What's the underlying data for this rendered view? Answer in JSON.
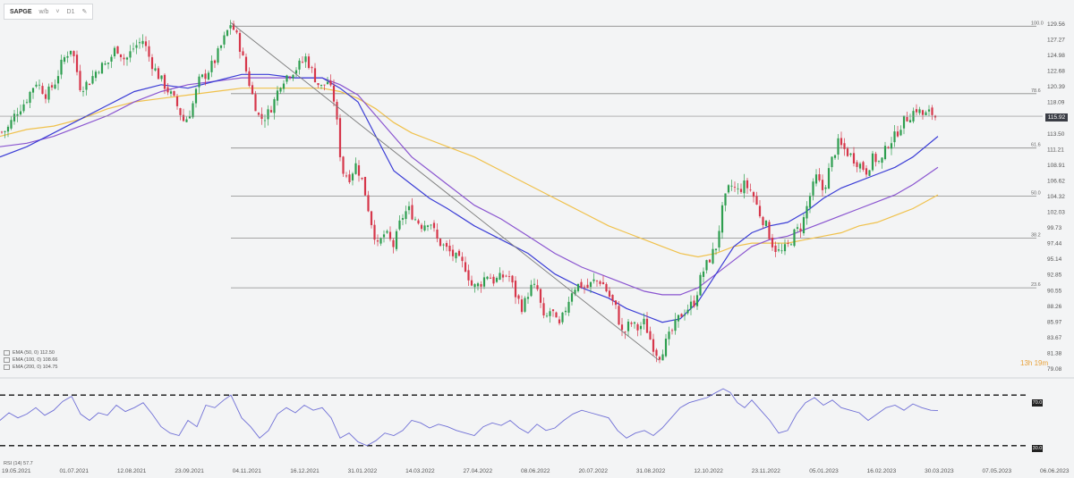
{
  "toolbar": {
    "symbol": "SAPGE",
    "interval_label": "w/b",
    "period_label": "D1"
  },
  "price_axis_labels": [
    "129.56",
    "127.27",
    "124.98",
    "122.68",
    "120.39",
    "118.09",
    "115.92",
    "113.50",
    "111.21",
    "108.91",
    "106.62",
    "104.32",
    "102.03",
    "99.73",
    "97.44",
    "95.14",
    "92.85",
    "90.55",
    "88.26",
    "85.97",
    "83.67",
    "81.38",
    "79.08"
  ],
  "current_price": "115.92",
  "countdown": "13h 19m",
  "legend": [
    {
      "label": "EMA (50, 0) 112.50",
      "color": "#3b3dd6"
    },
    {
      "label": "EMA (100, 0) 108.66",
      "color": "#8a55d0"
    },
    {
      "label": "EMA (200, 0) 104.75",
      "color": "#f0c14b"
    }
  ],
  "rsi": {
    "label": "RSI (14) 57.7",
    "upper": "70.0",
    "lower": "30.0"
  },
  "colors": {
    "up": "#2e9e4f",
    "down": "#d6364a",
    "ema50": "#3b3dd6",
    "ema100": "#8a55d0",
    "ema200": "#f0c14b",
    "rsi": "#6f6fd6",
    "fib": "#8a8a8a"
  },
  "chart_data": {
    "type": "candlestick",
    "x_tick_labels": [
      "19.05.2021",
      "01.07.2021",
      "12.08.2021",
      "23.09.2021",
      "04.11.2021",
      "16.12.2021",
      "31.01.2022",
      "14.03.2022",
      "27.04.2022",
      "08.06.2022",
      "20.07.2022",
      "31.08.2022",
      "12.10.2022",
      "23.11.2022",
      "05.01.2023",
      "16.02.2023",
      "30.03.2023",
      "07.05.2023",
      "06.06.2023"
    ],
    "ylim": [
      79.08,
      129.56
    ],
    "fibonacci_levels": [
      {
        "label": "100.0",
        "value": 129.0
      },
      {
        "label": "78.6",
        "value": 119.2
      },
      {
        "label": "61.6",
        "value": 111.3
      },
      {
        "label": "50.0",
        "value": 104.3
      },
      {
        "label": "38.2",
        "value": 98.2
      },
      {
        "label": "23.6",
        "value": 91.0
      }
    ],
    "price_path": [
      [
        0,
        113.5
      ],
      [
        8,
        114
      ],
      [
        18,
        116.5
      ],
      [
        28,
        118
      ],
      [
        40,
        121
      ],
      [
        52,
        119
      ],
      [
        62,
        121
      ],
      [
        70,
        124
      ],
      [
        80,
        126
      ],
      [
        90,
        120
      ],
      [
        100,
        121
      ],
      [
        110,
        123
      ],
      [
        120,
        123.5
      ],
      [
        130,
        126
      ],
      [
        140,
        124
      ],
      [
        150,
        126
      ],
      [
        160,
        127
      ],
      [
        168,
        124
      ],
      [
        176,
        122
      ],
      [
        186,
        120
      ],
      [
        196,
        118
      ],
      [
        206,
        115
      ],
      [
        214,
        117
      ],
      [
        222,
        121
      ],
      [
        230,
        122
      ],
      [
        240,
        124
      ],
      [
        250,
        127
      ],
      [
        258,
        129.5
      ],
      [
        266,
        127
      ],
      [
        274,
        123
      ],
      [
        282,
        119
      ],
      [
        290,
        115.5
      ],
      [
        298,
        116
      ],
      [
        306,
        118
      ],
      [
        314,
        121
      ],
      [
        322,
        122
      ],
      [
        332,
        123
      ],
      [
        342,
        124.5
      ],
      [
        350,
        122
      ],
      [
        358,
        120
      ],
      [
        366,
        121
      ],
      [
        374,
        118
      ],
      [
        382,
        108
      ],
      [
        390,
        107
      ],
      [
        398,
        109
      ],
      [
        406,
        106
      ],
      [
        414,
        101
      ],
      [
        422,
        97
      ],
      [
        430,
        99
      ],
      [
        440,
        97
      ],
      [
        448,
        101
      ],
      [
        456,
        102.5
      ],
      [
        464,
        101
      ],
      [
        472,
        100
      ],
      [
        480,
        101
      ],
      [
        488,
        98
      ],
      [
        496,
        97
      ],
      [
        504,
        96
      ],
      [
        512,
        95
      ],
      [
        520,
        94
      ],
      [
        528,
        91
      ],
      [
        536,
        91.5
      ],
      [
        544,
        93
      ],
      [
        552,
        92
      ],
      [
        560,
        92.5
      ],
      [
        568,
        93
      ],
      [
        576,
        90
      ],
      [
        584,
        88
      ],
      [
        592,
        91
      ],
      [
        600,
        91
      ],
      [
        608,
        86
      ],
      [
        616,
        88
      ],
      [
        624,
        85
      ],
      [
        632,
        88
      ],
      [
        640,
        91
      ],
      [
        648,
        91.5
      ],
      [
        656,
        91
      ],
      [
        664,
        92
      ],
      [
        672,
        92
      ],
      [
        680,
        90
      ],
      [
        688,
        88
      ],
      [
        696,
        84
      ],
      [
        704,
        86
      ],
      [
        712,
        85
      ],
      [
        720,
        86
      ],
      [
        728,
        83
      ],
      [
        736,
        81
      ],
      [
        744,
        83
      ],
      [
        752,
        85
      ],
      [
        760,
        87
      ],
      [
        768,
        88
      ],
      [
        776,
        89
      ],
      [
        784,
        93
      ],
      [
        792,
        95
      ],
      [
        800,
        97
      ],
      [
        808,
        103
      ],
      [
        816,
        106
      ],
      [
        824,
        105
      ],
      [
        832,
        106
      ],
      [
        840,
        105
      ],
      [
        848,
        102
      ],
      [
        856,
        100
      ],
      [
        864,
        97
      ],
      [
        872,
        96
      ],
      [
        880,
        97
      ],
      [
        888,
        99
      ],
      [
        896,
        100
      ],
      [
        904,
        104
      ],
      [
        912,
        107
      ],
      [
        920,
        105
      ],
      [
        928,
        109
      ],
      [
        936,
        112
      ],
      [
        944,
        111
      ],
      [
        952,
        110
      ],
      [
        960,
        109
      ],
      [
        968,
        108
      ],
      [
        976,
        110
      ],
      [
        984,
        109
      ],
      [
        992,
        112
      ],
      [
        1000,
        113
      ],
      [
        1008,
        115
      ],
      [
        1016,
        116
      ],
      [
        1024,
        117
      ],
      [
        1032,
        116
      ],
      [
        1040,
        116.5
      ],
      [
        1048,
        115.5
      ]
    ],
    "ema50_path": [
      [
        0,
        110
      ],
      [
        30,
        111.5
      ],
      [
        60,
        113.5
      ],
      [
        90,
        115.5
      ],
      [
        120,
        117.5
      ],
      [
        150,
        119.5
      ],
      [
        180,
        120.5
      ],
      [
        210,
        120
      ],
      [
        240,
        121
      ],
      [
        270,
        122
      ],
      [
        300,
        122
      ],
      [
        330,
        121.5
      ],
      [
        360,
        121.5
      ],
      [
        380,
        120
      ],
      [
        400,
        118
      ],
      [
        420,
        113
      ],
      [
        440,
        108
      ],
      [
        460,
        106
      ],
      [
        480,
        104
      ],
      [
        500,
        102.5
      ],
      [
        530,
        100
      ],
      [
        560,
        98
      ],
      [
        590,
        96
      ],
      [
        620,
        93
      ],
      [
        650,
        91
      ],
      [
        680,
        89.5
      ],
      [
        700,
        88
      ],
      [
        720,
        87
      ],
      [
        740,
        86
      ],
      [
        760,
        86.5
      ],
      [
        780,
        89
      ],
      [
        800,
        93
      ],
      [
        820,
        97
      ],
      [
        840,
        99
      ],
      [
        860,
        100
      ],
      [
        880,
        100.5
      ],
      [
        900,
        102
      ],
      [
        920,
        104
      ],
      [
        940,
        105.5
      ],
      [
        960,
        106.5
      ],
      [
        980,
        107.5
      ],
      [
        1000,
        108.5
      ],
      [
        1020,
        110
      ],
      [
        1048,
        113
      ]
    ],
    "ema100_path": [
      [
        0,
        111.5
      ],
      [
        30,
        112
      ],
      [
        60,
        113
      ],
      [
        90,
        114.5
      ],
      [
        120,
        116
      ],
      [
        150,
        118
      ],
      [
        180,
        119.5
      ],
      [
        210,
        120.5
      ],
      [
        240,
        121
      ],
      [
        270,
        121.5
      ],
      [
        300,
        121.5
      ],
      [
        330,
        121.5
      ],
      [
        360,
        121.5
      ],
      [
        380,
        120.5
      ],
      [
        400,
        119
      ],
      [
        420,
        116
      ],
      [
        440,
        113
      ],
      [
        460,
        110
      ],
      [
        480,
        108
      ],
      [
        500,
        106
      ],
      [
        530,
        103
      ],
      [
        560,
        101
      ],
      [
        590,
        98.5
      ],
      [
        620,
        96
      ],
      [
        650,
        94
      ],
      [
        680,
        92.5
      ],
      [
        700,
        91.5
      ],
      [
        720,
        90.5
      ],
      [
        740,
        90
      ],
      [
        760,
        90
      ],
      [
        780,
        91
      ],
      [
        800,
        93
      ],
      [
        820,
        95
      ],
      [
        840,
        97
      ],
      [
        860,
        98
      ],
      [
        880,
        98.5
      ],
      [
        900,
        99.5
      ],
      [
        920,
        100.5
      ],
      [
        940,
        101.5
      ],
      [
        960,
        102.5
      ],
      [
        980,
        103.5
      ],
      [
        1000,
        104.5
      ],
      [
        1020,
        106
      ],
      [
        1048,
        108.5
      ]
    ],
    "ema200_path": [
      [
        0,
        113
      ],
      [
        30,
        114
      ],
      [
        60,
        114.5
      ],
      [
        90,
        115.5
      ],
      [
        120,
        117
      ],
      [
        150,
        118
      ],
      [
        180,
        118.5
      ],
      [
        210,
        119
      ],
      [
        240,
        119.5
      ],
      [
        270,
        120
      ],
      [
        300,
        120
      ],
      [
        330,
        120
      ],
      [
        360,
        120
      ],
      [
        380,
        119.5
      ],
      [
        400,
        118.5
      ],
      [
        420,
        117
      ],
      [
        440,
        115
      ],
      [
        460,
        113.5
      ],
      [
        480,
        112.5
      ],
      [
        500,
        111.5
      ],
      [
        530,
        110
      ],
      [
        560,
        108
      ],
      [
        590,
        106
      ],
      [
        620,
        104
      ],
      [
        650,
        102
      ],
      [
        680,
        100
      ],
      [
        700,
        99
      ],
      [
        720,
        98
      ],
      [
        740,
        97
      ],
      [
        760,
        96
      ],
      [
        780,
        95.5
      ],
      [
        800,
        96
      ],
      [
        820,
        97
      ],
      [
        840,
        97.5
      ],
      [
        860,
        97.5
      ],
      [
        880,
        97.5
      ],
      [
        900,
        98
      ],
      [
        920,
        98.5
      ],
      [
        940,
        99
      ],
      [
        960,
        100
      ],
      [
        980,
        100.5
      ],
      [
        1000,
        101.5
      ],
      [
        1020,
        102.5
      ],
      [
        1048,
        104.5
      ]
    ],
    "trendline": [
      [
        258,
        129.5
      ],
      [
        736,
        80.5
      ]
    ],
    "rsi_path": [
      [
        0,
        50
      ],
      [
        10,
        56
      ],
      [
        20,
        52
      ],
      [
        30,
        55
      ],
      [
        40,
        60
      ],
      [
        50,
        54
      ],
      [
        60,
        58
      ],
      [
        70,
        65
      ],
      [
        80,
        69
      ],
      [
        90,
        55
      ],
      [
        100,
        50
      ],
      [
        110,
        56
      ],
      [
        120,
        54
      ],
      [
        130,
        62
      ],
      [
        140,
        57
      ],
      [
        150,
        60
      ],
      [
        160,
        64
      ],
      [
        170,
        55
      ],
      [
        180,
        45
      ],
      [
        190,
        40
      ],
      [
        200,
        38
      ],
      [
        210,
        50
      ],
      [
        220,
        45
      ],
      [
        230,
        62
      ],
      [
        240,
        60
      ],
      [
        250,
        66
      ],
      [
        258,
        70
      ],
      [
        270,
        52
      ],
      [
        280,
        45
      ],
      [
        290,
        36
      ],
      [
        300,
        42
      ],
      [
        310,
        55
      ],
      [
        320,
        60
      ],
      [
        330,
        56
      ],
      [
        340,
        62
      ],
      [
        350,
        58
      ],
      [
        360,
        60
      ],
      [
        370,
        52
      ],
      [
        380,
        36
      ],
      [
        390,
        40
      ],
      [
        400,
        33
      ],
      [
        410,
        30
      ],
      [
        420,
        34
      ],
      [
        430,
        40
      ],
      [
        440,
        38
      ],
      [
        450,
        42
      ],
      [
        460,
        50
      ],
      [
        470,
        48
      ],
      [
        480,
        44
      ],
      [
        490,
        47
      ],
      [
        500,
        45
      ],
      [
        510,
        42
      ],
      [
        520,
        40
      ],
      [
        530,
        38
      ],
      [
        540,
        45
      ],
      [
        550,
        48
      ],
      [
        560,
        46
      ],
      [
        570,
        50
      ],
      [
        580,
        44
      ],
      [
        590,
        40
      ],
      [
        600,
        47
      ],
      [
        610,
        42
      ],
      [
        620,
        44
      ],
      [
        630,
        50
      ],
      [
        640,
        55
      ],
      [
        650,
        58
      ],
      [
        660,
        56
      ],
      [
        670,
        54
      ],
      [
        680,
        52
      ],
      [
        690,
        42
      ],
      [
        700,
        36
      ],
      [
        710,
        40
      ],
      [
        720,
        42
      ],
      [
        730,
        38
      ],
      [
        740,
        44
      ],
      [
        750,
        52
      ],
      [
        760,
        60
      ],
      [
        770,
        64
      ],
      [
        780,
        66
      ],
      [
        790,
        68
      ],
      [
        800,
        72
      ],
      [
        808,
        75
      ],
      [
        816,
        72
      ],
      [
        824,
        64
      ],
      [
        832,
        60
      ],
      [
        840,
        66
      ],
      [
        850,
        58
      ],
      [
        860,
        50
      ],
      [
        870,
        40
      ],
      [
        880,
        42
      ],
      [
        890,
        55
      ],
      [
        900,
        64
      ],
      [
        910,
        68
      ],
      [
        920,
        62
      ],
      [
        930,
        66
      ],
      [
        940,
        60
      ],
      [
        950,
        58
      ],
      [
        960,
        56
      ],
      [
        970,
        50
      ],
      [
        980,
        55
      ],
      [
        990,
        60
      ],
      [
        1000,
        62
      ],
      [
        1010,
        58
      ],
      [
        1020,
        63
      ],
      [
        1030,
        60
      ],
      [
        1040,
        58
      ],
      [
        1048,
        57.7
      ]
    ]
  }
}
